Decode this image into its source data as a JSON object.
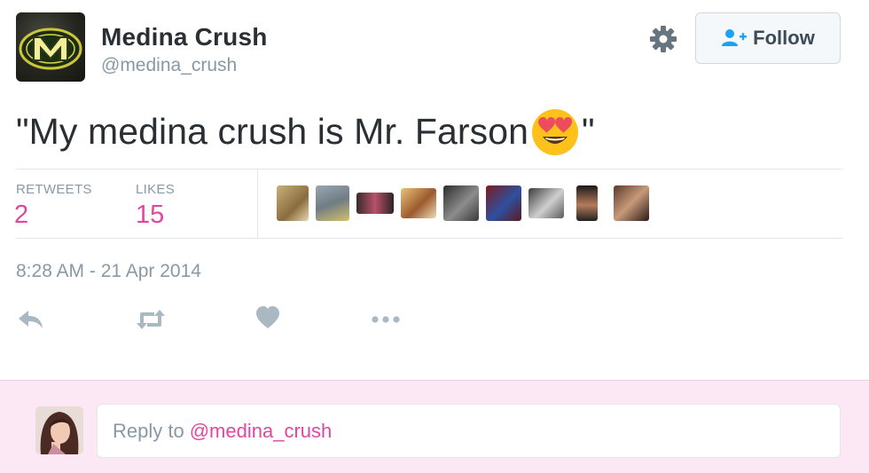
{
  "profile": {
    "display_name": "Medina Crush",
    "handle": "@medina_crush",
    "avatar_icon": "medina-m-logo-icon"
  },
  "header": {
    "settings_icon": "gear-icon",
    "follow_label": "Follow",
    "follow_icon": "add-user-icon"
  },
  "tweet": {
    "text_before_emoji": "\"My medina crush is Mr. Farson",
    "emoji": "heart-eyes-emoji",
    "text_after_emoji": "\"",
    "timestamp": "8:28 AM - 21 Apr 2014"
  },
  "stats": {
    "retweets_label": "RETWEETS",
    "retweets_value": "2",
    "likes_label": "LIKES",
    "likes_value": "15",
    "liker_avatar_count": 9
  },
  "actions": [
    {
      "name": "reply-icon"
    },
    {
      "name": "retweet-icon"
    },
    {
      "name": "like-heart-icon"
    },
    {
      "name": "more-dots-icon"
    }
  ],
  "reply_box": {
    "prefix": "Reply to",
    "mention": "@medina_crush"
  },
  "colors": {
    "accent_pink": "#e0479e",
    "muted": "#8899a6",
    "text": "#292f33",
    "reply_bg": "#fce8f5"
  }
}
